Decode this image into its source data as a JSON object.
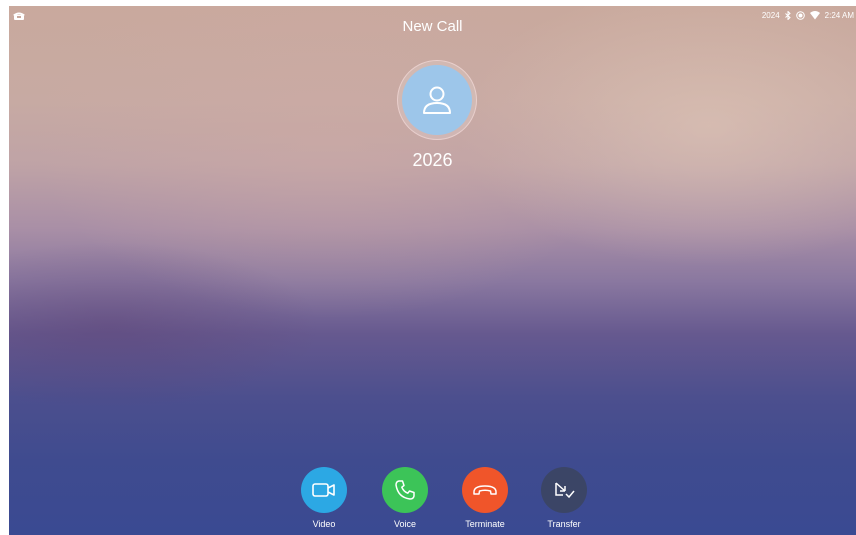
{
  "status_bar": {
    "left_icon": "phone-icon",
    "extension": "2024",
    "icons": [
      "bluetooth-icon",
      "record-icon",
      "wifi-icon"
    ],
    "time": "2:24 AM"
  },
  "call": {
    "title": "New Call",
    "avatar_icon": "person-icon",
    "number": "2026"
  },
  "actions": [
    {
      "label": "Video",
      "icon": "video-camera-icon",
      "color": "#2ca8e4"
    },
    {
      "label": "Voice",
      "icon": "phone-handset-icon",
      "color": "#3cc458"
    },
    {
      "label": "Terminate",
      "icon": "hang-up-icon",
      "color": "#f0552a"
    },
    {
      "label": "Transfer",
      "icon": "transfer-icon",
      "color": "#3b4566"
    }
  ],
  "colors": {
    "avatar": "#9dc6ea",
    "text": "#ffffff"
  }
}
